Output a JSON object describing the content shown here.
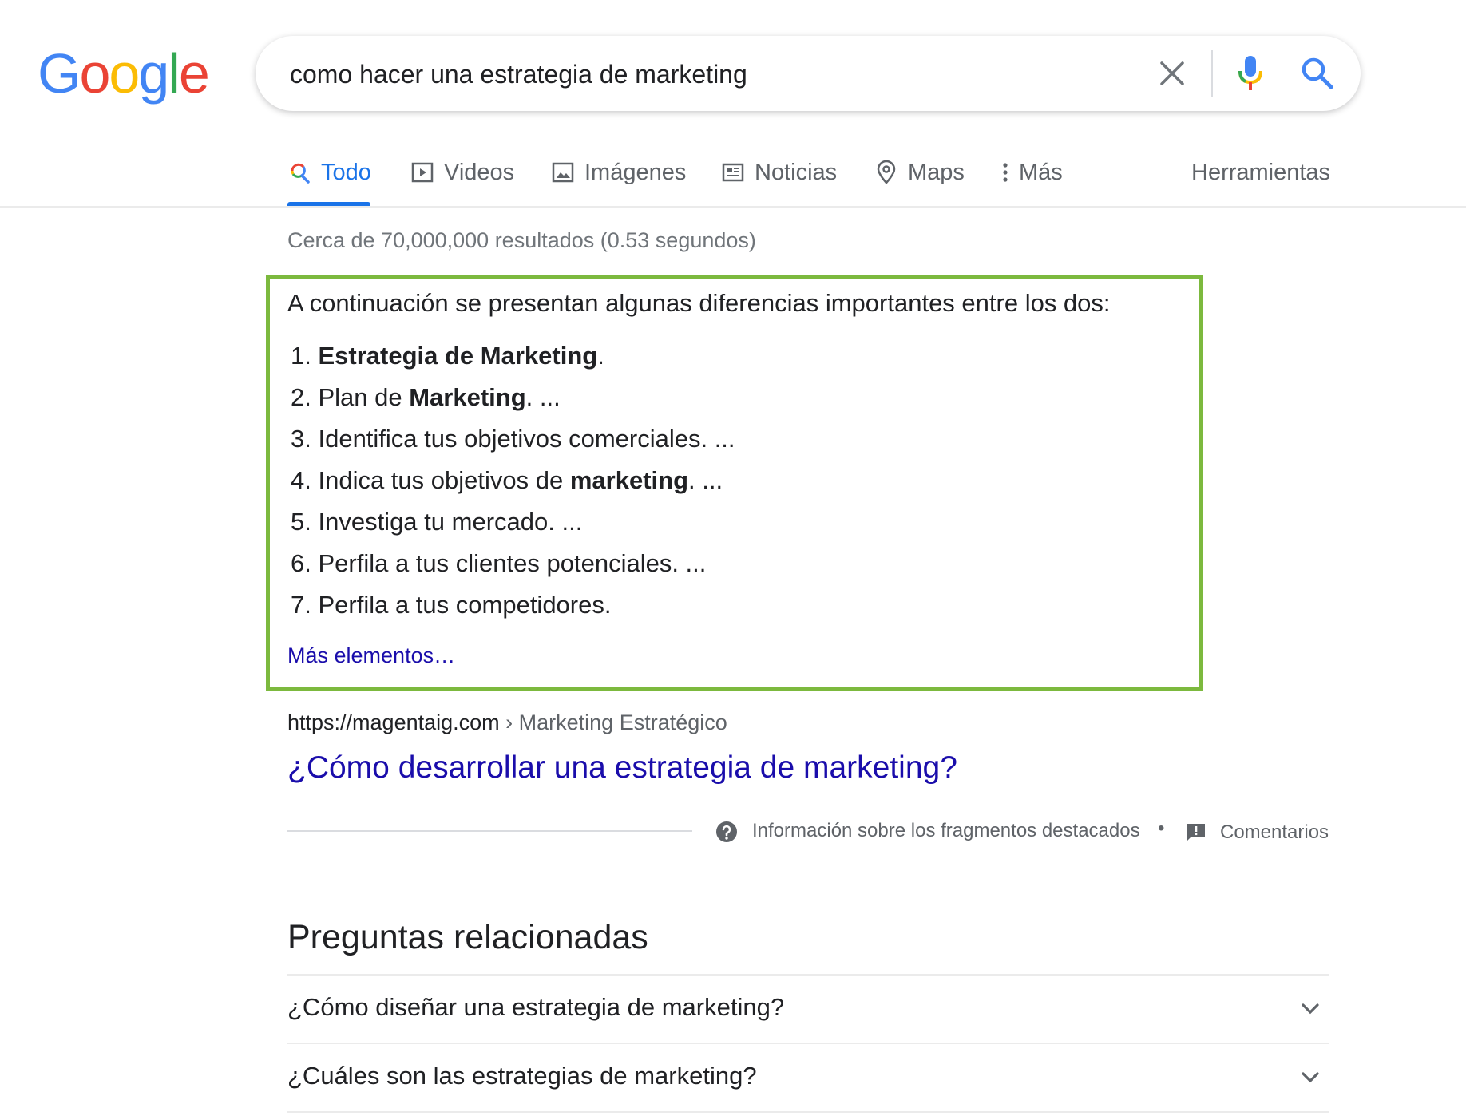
{
  "logo": {
    "letters": [
      "G",
      "o",
      "o",
      "g",
      "l",
      "e"
    ],
    "colors": [
      "#4285f4",
      "#ea4335",
      "#fbbc05",
      "#4285f4",
      "#34a853",
      "#ea4335"
    ]
  },
  "search": {
    "query": "como hacer una estrategia de marketing"
  },
  "tabs": [
    {
      "label": "Todo",
      "icon": "search-icon",
      "active": true
    },
    {
      "label": "Videos",
      "icon": "play-icon"
    },
    {
      "label": "Imágenes",
      "icon": "image-icon"
    },
    {
      "label": "Noticias",
      "icon": "news-icon"
    },
    {
      "label": "Maps",
      "icon": "map-pin-icon"
    },
    {
      "label": "Más",
      "icon": "more-vert-icon"
    }
  ],
  "tools_label": "Herramientas",
  "result_stats": "Cerca de 70,000,000 resultados (0.53 segundos)",
  "snippet": {
    "heading": "A continuación se presentan algunas diferencias importantes entre los dos:",
    "items": [
      {
        "num": "1.",
        "pre": " ",
        "bold": "Estrategia de Marketing",
        "post": "."
      },
      {
        "num": "2.",
        "pre": " Plan de ",
        "bold": "Marketing",
        "post": ". ..."
      },
      {
        "num": "3.",
        "pre": " Identifica tus objetivos comerciales. ...",
        "bold": "",
        "post": ""
      },
      {
        "num": "4.",
        "pre": " Indica tus objetivos de ",
        "bold": "marketing",
        "post": ". ..."
      },
      {
        "num": "5.",
        "pre": " Investiga tu mercado. ...",
        "bold": "",
        "post": ""
      },
      {
        "num": "6.",
        "pre": " Perfila a tus clientes potenciales. ...",
        "bold": "",
        "post": ""
      },
      {
        "num": "7.",
        "pre": " Perfila a tus competidores.",
        "bold": "",
        "post": ""
      }
    ],
    "more_link": "Más elementos…",
    "highlight_color": "#7cb93e"
  },
  "result": {
    "url_domain": "https://magentaig.com",
    "url_sep": " › ",
    "url_crumb": "Marketing Estratégico",
    "title": "¿Cómo desarrollar una estrategia de marketing?"
  },
  "snippet_footer": {
    "about": "Información sobre los fragmentos destacados",
    "dot": "•",
    "feedback": "Comentarios"
  },
  "related": {
    "title": "Preguntas relacionadas",
    "questions": [
      "¿Cómo diseñar una estrategia de marketing?",
      "¿Cuáles son las estrategias de marketing?"
    ]
  }
}
